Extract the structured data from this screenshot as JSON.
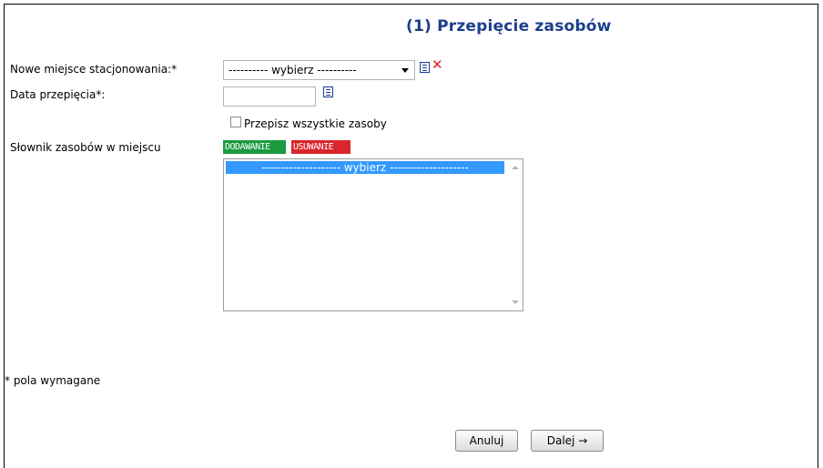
{
  "page": {
    "title": "(1) Przepięcie zasobów",
    "required_note": "* pola wymagane"
  },
  "form": {
    "location_label": "Nowe miejsce stacjonowania:*",
    "location_select_value": "---------- wybierz ----------",
    "date_label": "Data przepięcia*:",
    "date_value": "",
    "copy_all_label": "Przepisz wszystkie zasoby",
    "copy_all_checked": false,
    "dictionary_label": "Słownik zasobów w miejscu",
    "add_tag_label": "DODAWANIE",
    "remove_tag_label": "USUWANIE",
    "listbox_options": [
      "-------------------- wybierz --------------------"
    ]
  },
  "buttons": {
    "cancel_label": "Anuluj",
    "next_label": "Dalej →"
  },
  "colors": {
    "title": "#1c3f8c",
    "add_tag": "#1b9a3f",
    "remove_tag": "#d9262c",
    "selected_option": "#3399ff"
  },
  "icons": {
    "location_list": "list-icon",
    "location_clear": "clear-x-icon",
    "date_picker": "list-icon"
  }
}
